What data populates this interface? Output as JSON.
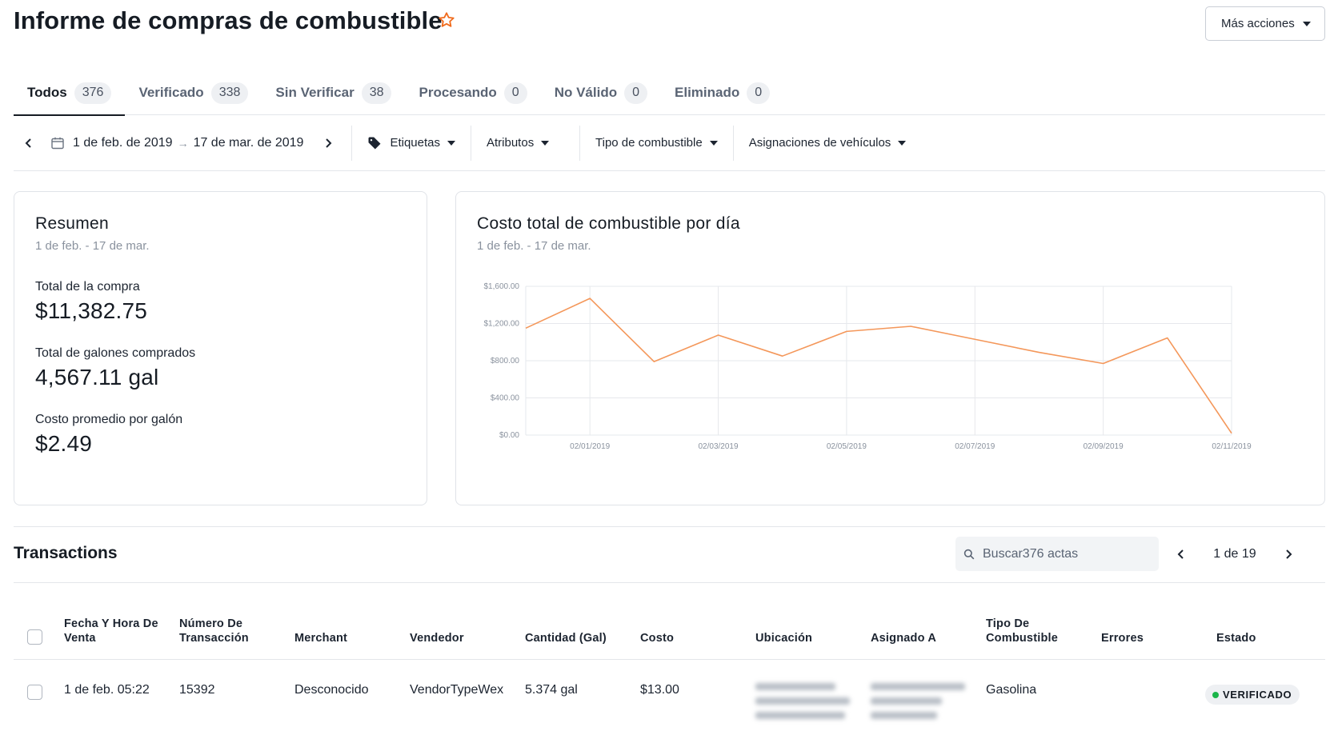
{
  "header": {
    "title": "Informe de compras de combustible",
    "favorite_icon": "star-outline-icon",
    "more_actions_label": "Más acciones"
  },
  "tabs": [
    {
      "label": "Todos",
      "count": "376",
      "active": true
    },
    {
      "label": "Verificado",
      "count": "338"
    },
    {
      "label": "Sin Verificar",
      "count": "38"
    },
    {
      "label": "Procesando",
      "count": "0"
    },
    {
      "label": "No Válido",
      "count": "0"
    },
    {
      "label": "Eliminado",
      "count": "0"
    }
  ],
  "filters": {
    "date_start": "1 de feb. de 2019",
    "date_arrow": "→",
    "date_end": "17 de mar. de 2019",
    "tags_label": "Etiquetas",
    "attributes_label": "Atributos",
    "fuel_type_label": "Tipo de combustible",
    "vehicle_assign_label": "Asignaciones de vehículos"
  },
  "summary": {
    "title": "Resumen",
    "subtitle": "1 de feb. - 17 de mar.",
    "total_purchase_label": "Total de la compra",
    "total_purchase_value": "$11,382.75",
    "total_gallons_label": "Total de galones comprados",
    "total_gallons_value": "4,567.11 gal",
    "avg_cost_label": "Costo promedio por galón",
    "avg_cost_value": "$2.49"
  },
  "chart_card": {
    "title": "Costo total de combustible por día",
    "subtitle": "1 de feb. - 17 de mar."
  },
  "chart_data": {
    "type": "line",
    "color": "#f4975a",
    "x_tick_labels": [
      "02/01/2019",
      "02/03/2019",
      "02/05/2019",
      "02/07/2019",
      "02/09/2019",
      "02/11/2019"
    ],
    "y_tick_labels": [
      "$0.00",
      "$400.00",
      "$800.00",
      "$1,200.00",
      "$1,600.00"
    ],
    "ylim": [
      0,
      1600
    ],
    "grid": true,
    "series": [
      {
        "x": [
          "01/31/2019",
          "02/01/2019",
          "02/02/2019",
          "02/03/2019",
          "02/04/2019",
          "02/05/2019",
          "02/06/2019",
          "02/07/2019",
          "02/08/2019",
          "02/09/2019",
          "02/10/2019",
          "02/11/2019"
        ],
        "values": [
          1150,
          1470,
          790,
          1075,
          850,
          1115,
          1170,
          1030,
          890,
          770,
          1045,
          20
        ]
      }
    ]
  },
  "transactions": {
    "title": "Transactions",
    "search_placeholder": "Buscar376 actas",
    "page_current": "1",
    "page_of": "de",
    "page_total": "19",
    "columns": [
      "Fecha Y Hora De Venta",
      "Número De Transacción",
      "Merchant",
      "Vendedor",
      "Cantidad (Gal)",
      "Costo",
      "Ubicación",
      "Asignado A",
      "Tipo De Combustible",
      "Errores",
      "Estado"
    ],
    "rows": [
      {
        "date": "1 de feb. 05:22",
        "number": "15392",
        "merchant": "Desconocido",
        "vendor": "VendorTypeWex",
        "quantity": "5.374 gal",
        "cost": "$13.00",
        "fuel_type": "Gasolina",
        "errors": "",
        "status": "VERIFICADO",
        "status_color": "#1bb54a"
      }
    ]
  }
}
